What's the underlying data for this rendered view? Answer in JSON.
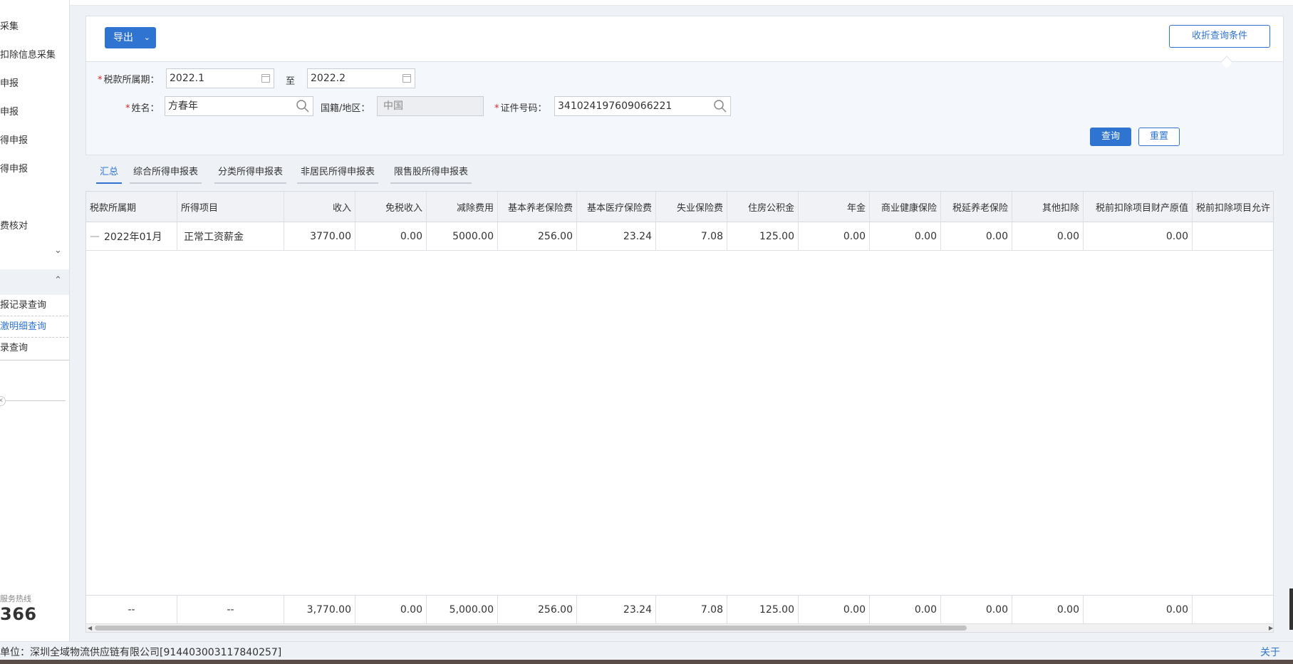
{
  "sidebar": {
    "items": [
      "采集",
      "扣除信息采集",
      "申报",
      "申报",
      "得申报",
      "得申报",
      "费核对"
    ],
    "submenu": [
      "报记录查询",
      "激明细查询",
      "录查询"
    ],
    "hotline_label": "服务热线",
    "hotline_number": "366"
  },
  "toolbar": {
    "export_label": "导出",
    "collapse_label": "收折查询条件"
  },
  "form": {
    "period_label": "税款所属期：",
    "period_from": "2022.1",
    "to_label": "至",
    "period_to": "2022.2",
    "name_label": "姓名：",
    "name_value": "方春年",
    "nationality_label": "国籍/地区：",
    "nationality_value": "中国",
    "id_label": "证件号码：",
    "id_value": "341024197609066221",
    "query_label": "查询",
    "reset_label": "重置"
  },
  "tabs": [
    "汇总",
    "综合所得申报表",
    "分类所得申报表",
    "非居民所得申报表",
    "限售股所得申报表"
  ],
  "table": {
    "headers": [
      "税款所属期",
      "所得项目",
      "收入",
      "免税收入",
      "减除费用",
      "基本养老保险费",
      "基本医疗保险费",
      "失业保险费",
      "住房公积金",
      "年金",
      "商业健康保险",
      "税延养老保险",
      "其他扣除",
      "税前扣除项目财产原值",
      "税前扣除项目允许"
    ],
    "row": [
      "2022年01月",
      "正常工资薪金",
      "3770.00",
      "0.00",
      "5000.00",
      "256.00",
      "23.24",
      "7.08",
      "125.00",
      "0.00",
      "0.00",
      "0.00",
      "0.00",
      "0.00",
      ""
    ],
    "row_expander": "—",
    "footer": [
      "--",
      "--",
      "3,770.00",
      "0.00",
      "5,000.00",
      "256.00",
      "23.24",
      "7.08",
      "125.00",
      "0.00",
      "0.00",
      "0.00",
      "0.00",
      "0.00",
      ""
    ]
  },
  "status": {
    "unit_text": "单位：深圳全域物流供应链有限公司[914403003117840257]",
    "about_label": "关于"
  },
  "colors": {
    "primary": "#2f74d0",
    "required": "#e02424"
  }
}
